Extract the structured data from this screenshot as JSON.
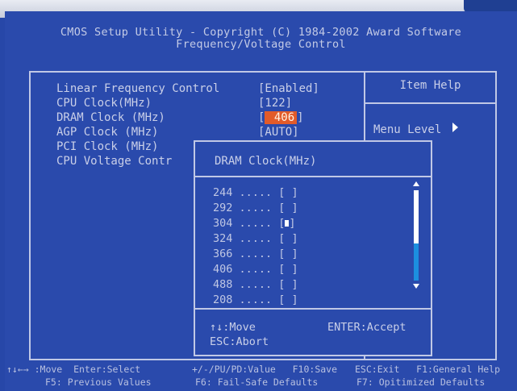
{
  "header": {
    "line1": "CMOS Setup  Utility - Copyright (C) 1984-2002 Award Software",
    "line2": "Frequency/Voltage Control"
  },
  "settings": [
    {
      "label": "Linear Frequency Control",
      "value": "[Enabled]"
    },
    {
      "label": "CPU Clock(MHz)",
      "value": "[122]"
    },
    {
      "label": "DRAM Clock (MHz)",
      "value_prefix": "[",
      "value_selected": " 406",
      "value_suffix": "]"
    },
    {
      "label": "AGP Clock (MHz)",
      "value": "[AUTO]"
    },
    {
      "label": "PCI Clock (MHz)",
      "value": ""
    },
    {
      "label": "CPU Voltage Contr",
      "value": ""
    }
  ],
  "help": {
    "title": "Item Help",
    "menu_level": "Menu Level"
  },
  "popup": {
    "title": "DRAM Clock(MHz)",
    "options": [
      {
        "text": "244 ..... [ ]",
        "selected": false
      },
      {
        "text": "292 ..... [ ]",
        "selected": false
      },
      {
        "text": "304 ..... [",
        "text_end": "]",
        "selected": true
      },
      {
        "text": "324 ..... [ ]",
        "selected": false
      },
      {
        "text": "366 ..... [ ]",
        "selected": false
      },
      {
        "text": "406 ..... [ ]",
        "selected": false
      },
      {
        "text": "488 ..... [ ]",
        "selected": false
      },
      {
        "text": "208 ..... [ ]",
        "selected": false
      }
    ],
    "move_hint": "↑↓:Move",
    "accept_hint": "ENTER:Accept",
    "abort_hint": "ESC:Abort"
  },
  "footer": {
    "row1": [
      "↑↓←→ :Move  Enter:Select",
      "+/-/PU/PD:Value   F10:Save",
      "ESC:Exit   F1:General Help"
    ],
    "row2": [
      "F5: Previous Values",
      "F6: Fail-Safe Defaults",
      "F7: Opitimized Defaults"
    ]
  },
  "colors": {
    "background": "#2a4aac",
    "text": "#c9cfe8",
    "highlight": "#e25b2a",
    "scroll_thumb": "#1c8fe0"
  }
}
